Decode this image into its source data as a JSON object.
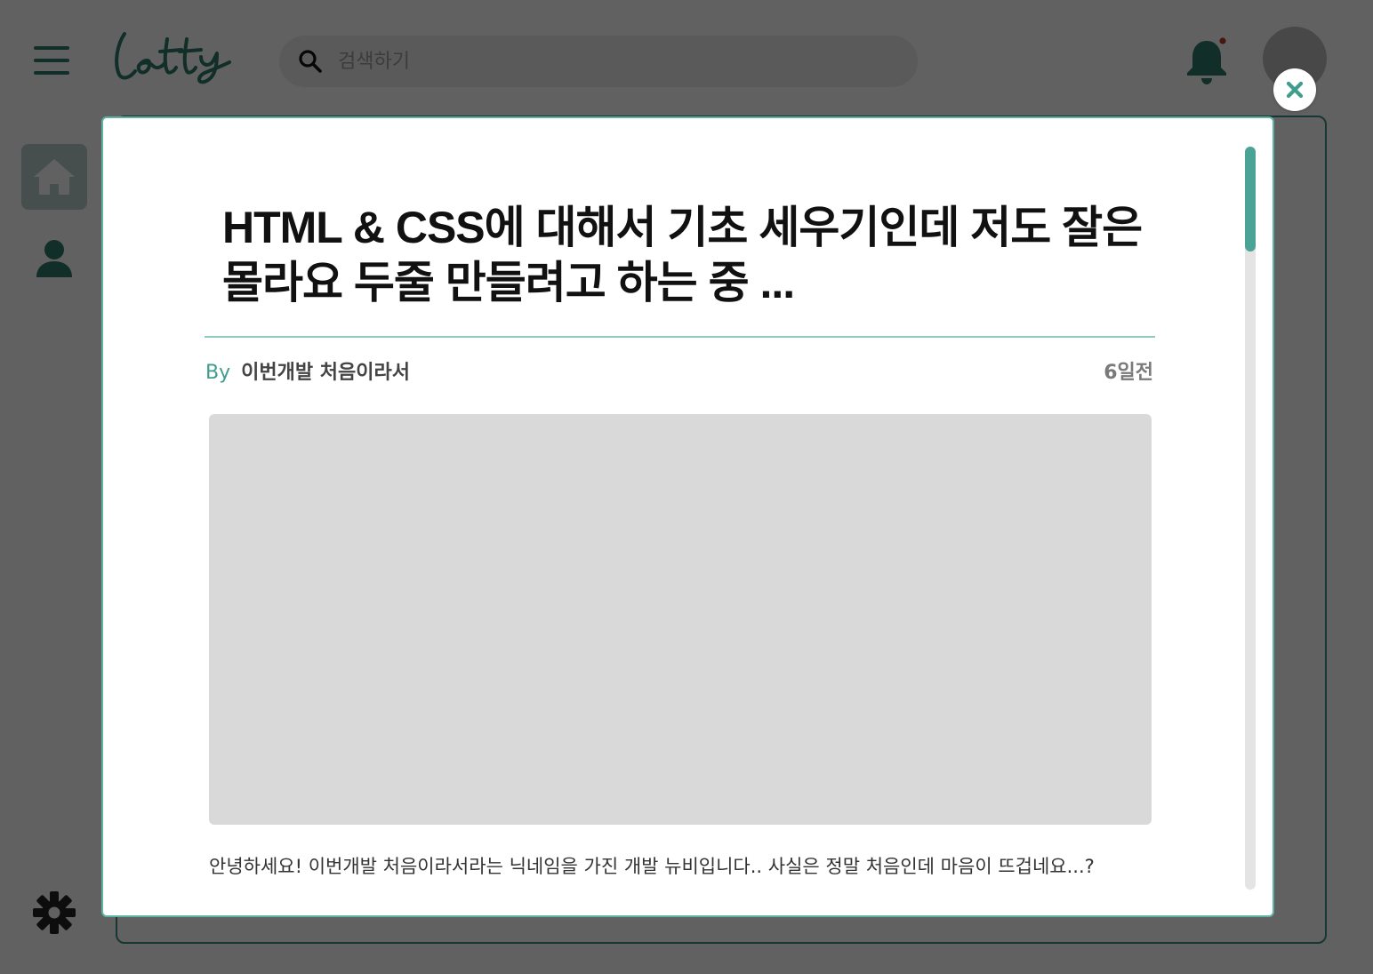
{
  "app": {
    "logo_text": "letty",
    "search": {
      "placeholder": "검색하기",
      "value": ""
    },
    "notification_has_unread": true
  },
  "colors": {
    "accent": "#2f7a6d",
    "accent_light": "#4aa394",
    "overlay": "rgba(0,0,0,0.62)",
    "notification_dot": "#c0392b"
  },
  "icons": {
    "menu": "hamburger-icon",
    "search": "search-icon",
    "notification": "bell-icon",
    "home": "home-icon",
    "profile": "user-icon",
    "settings": "gear-icon",
    "close": "close-icon"
  },
  "modal": {
    "title": "HTML & CSS에 대해서 기초 세우기인데 저도 잘은 몰라요 두줄 만들려고 하는 중 ...",
    "by_label": "By",
    "author": "이번개발 처음이라서",
    "time": "6일전",
    "body": "안녕하세요! 이번개발 처음이라서라는 닉네임을 가진 개발 뉴비입니다.. 사실은 정말 처음인데 마음이 뜨겁네요...?",
    "scroll_position": 0.0
  }
}
